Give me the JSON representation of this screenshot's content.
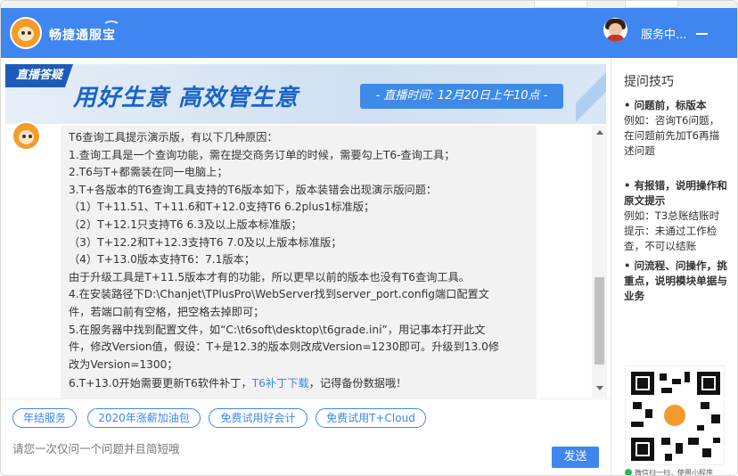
{
  "header": {
    "brand": "畅捷通服宝",
    "agent_status": "服务中..."
  },
  "banner": {
    "tag": "直播答疑",
    "title": "用好生意  高效管生意",
    "time": "- 直播时间: 12月20日上午10点 -"
  },
  "message": {
    "lines": [
      "T6查询工具提示演示版，有以下几种原因：",
      "1.查询工具是一个查询功能，需在提交商务订单的时候，需要勾上T6-查询工具；",
      "2.T6与T+都需装在同一电脑上；",
      "3.T+各版本的T6查询工具支持的T6版本如下，版本装错会出现演示版问题：",
      "（1）T+11.51、T+11.6和T+12.0支持T6 6.2plus1标准版；",
      "（2）T+12.1只支持T6 6.3及以上版本标准版；",
      "（3）T+12.2和T+12.3支持T6 7.0及以上版本标准版；",
      "（4）T+13.0版本支持T6：7.1版本；",
      "由于升级工具是T+11.5版本才有的功能，所以更早以前的版本也没有T6查询工具。",
      "4.在安装路径下D:\\Chanjet\\TPlusPro\\WebServer找到server_port.config端口配置文",
      "件，若端口前有空格，把空格去掉即可；",
      "5.在服务器中找到配置文件，如“C:\\t6soft\\desktop\\t6grade.ini”，用记事本打开此文",
      "件，修改Version值，假设：T+是12.3的版本则改成Version=1230即可。升级到13.0修",
      "改为Version=1300；"
    ],
    "last_line_pre": "6.T+13.0开始需要更新T6软件补丁，",
    "last_line_link": "T6补丁下载",
    "last_line_post": "，记得备份数据哦！"
  },
  "quick_replies": [
    "年结服务",
    "2020年涨薪加油包",
    "免费试用好会计",
    "免费试用T+Cloud"
  ],
  "input": {
    "placeholder": "请您一次仅问一个问题并且简短哦",
    "send_label": "发送"
  },
  "sidebar": {
    "title": "提问技巧",
    "tip1_head": "• 问题前，标版本",
    "tip1_body": "例如：咨询T6问题，在问题前先加T6再描述问题",
    "tip2_head": "• 有报错，说明操作和原文提示",
    "tip2_body": "例如：T3总账结账时提示：未通过工作检查，不可以结账",
    "tip3_head": "• 问流程、问操作，挑重点，说明模块单据与业务",
    "qr_caption": "微信扫一扫，使用小程序"
  },
  "colors": {
    "header": "#3f86f0",
    "accent": "#3f86f0",
    "banner_title": "#1a64c8"
  }
}
